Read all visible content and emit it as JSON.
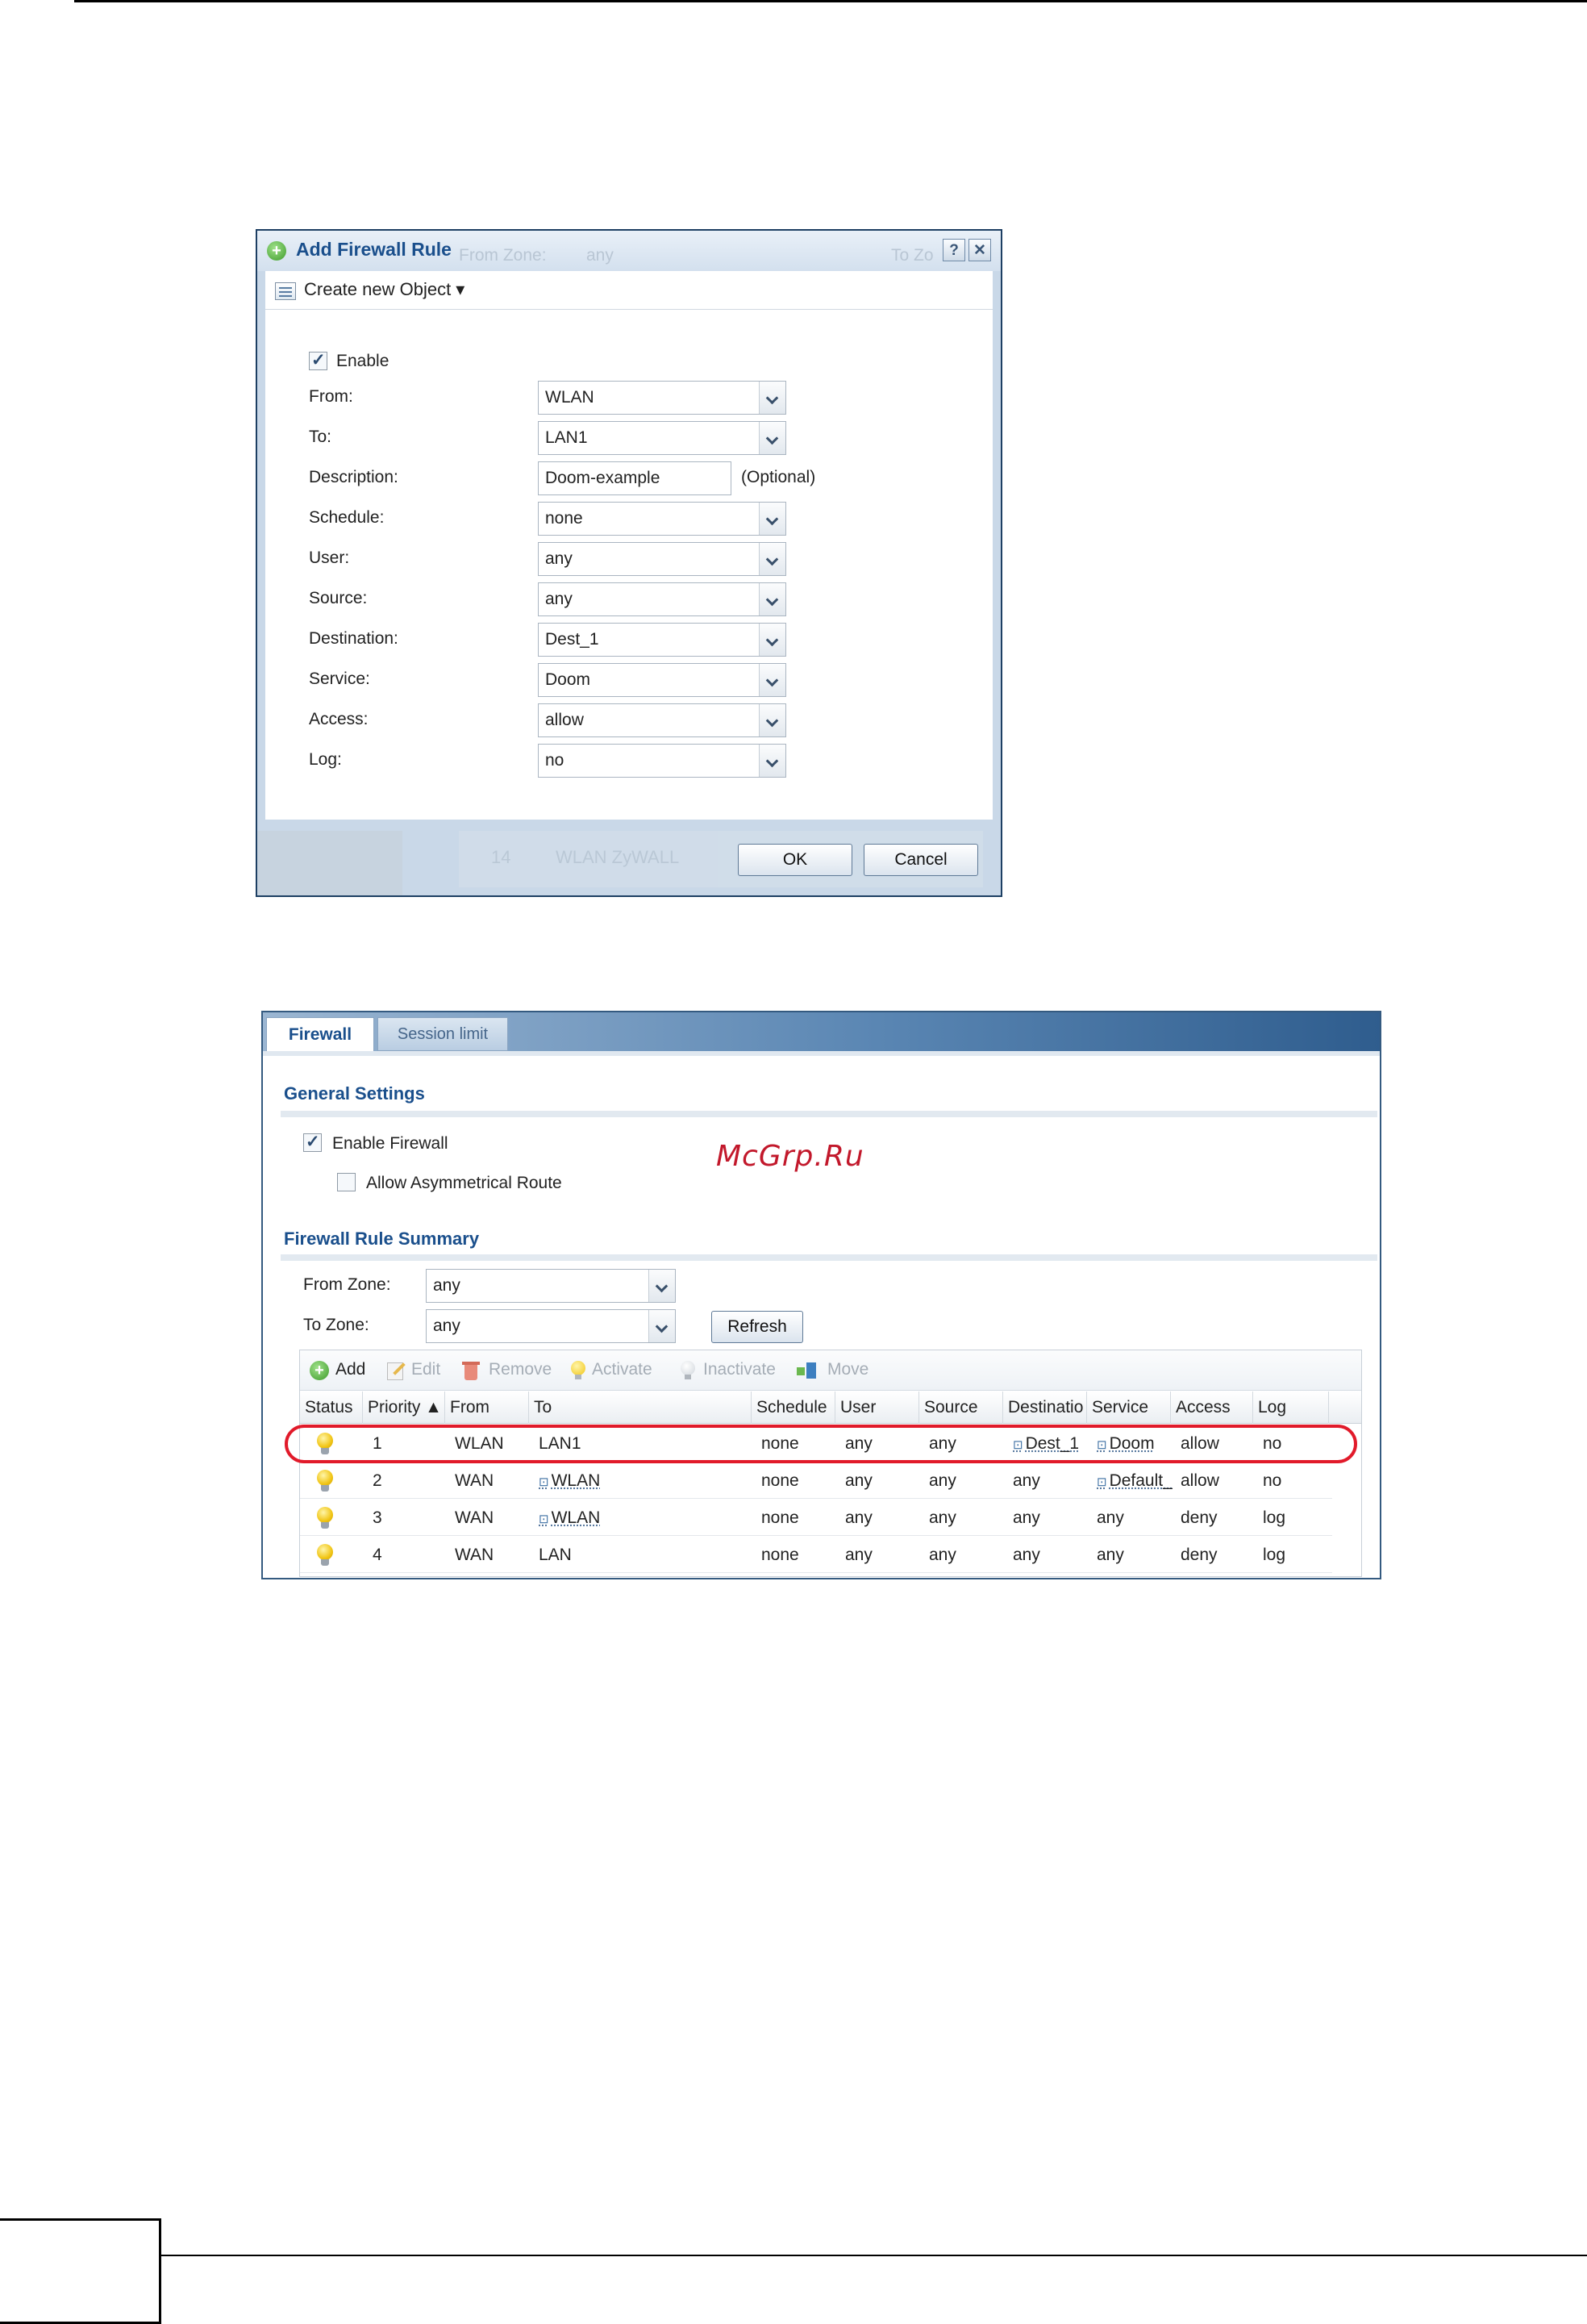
{
  "dialog": {
    "title": "Add Firewall Rule",
    "bg_from_zone": "From Zone:",
    "bg_from_value": "any",
    "bg_to_zone": "To Zo",
    "bg_row_num": "14",
    "bg_row_text": "WLAN ZyWALL",
    "help_label": "?",
    "close_label": "✕",
    "create_object_label": "Create new Object ▾",
    "enable_label": "Enable",
    "enable_checked": true,
    "fields": {
      "from": {
        "label": "From:",
        "value": "WLAN"
      },
      "to": {
        "label": "To:",
        "value": "LAN1"
      },
      "description": {
        "label": "Description:",
        "value": "Doom-example",
        "hint": "(Optional)"
      },
      "schedule": {
        "label": "Schedule:",
        "value": "none"
      },
      "user": {
        "label": "User:",
        "value": "any"
      },
      "source": {
        "label": "Source:",
        "value": "any"
      },
      "destination": {
        "label": "Destination:",
        "value": "Dest_1"
      },
      "service": {
        "label": "Service:",
        "value": "Doom"
      },
      "access": {
        "label": "Access:",
        "value": "allow"
      },
      "log": {
        "label": "Log:",
        "value": "no"
      }
    },
    "ok_label": "OK",
    "cancel_label": "Cancel"
  },
  "firewall": {
    "tabs": [
      {
        "label": "Firewall"
      },
      {
        "label": "Session limit"
      }
    ],
    "general_settings_title": "General Settings",
    "enable_firewall_label": "Enable Firewall",
    "enable_firewall_checked": true,
    "allow_asym_label": "Allow Asymmetrical Route",
    "allow_asym_checked": false,
    "rule_summary_title": "Firewall Rule Summary",
    "from_zone_label": "From Zone:",
    "from_zone_value": "any",
    "to_zone_label": "To Zone:",
    "to_zone_value": "any",
    "refresh_label": "Refresh",
    "toolbar": {
      "add": "Add",
      "edit": "Edit",
      "remove": "Remove",
      "activate": "Activate",
      "inactivate": "Inactivate",
      "move": "Move"
    },
    "columns": [
      "Status",
      "Priority ▲",
      "From",
      "To",
      "Schedule",
      "User",
      "Source",
      "Destinatio",
      "Service",
      "Access",
      "Log"
    ],
    "rows": [
      {
        "priority": "1",
        "from": "WLAN",
        "to": "LAN1",
        "schedule": "none",
        "user": "any",
        "source": "any",
        "destination": "Dest_1",
        "service": "Doom",
        "access": "allow",
        "log": "no"
      },
      {
        "priority": "2",
        "from": "WAN",
        "to": "WLAN",
        "schedule": "none",
        "user": "any",
        "source": "any",
        "destination": "any",
        "service": "Default_",
        "access": "allow",
        "log": "no"
      },
      {
        "priority": "3",
        "from": "WAN",
        "to": "WLAN",
        "schedule": "none",
        "user": "any",
        "source": "any",
        "destination": "any",
        "service": "any",
        "access": "deny",
        "log": "log"
      },
      {
        "priority": "4",
        "from": "WAN",
        "to": "LAN",
        "schedule": "none",
        "user": "any",
        "source": "any",
        "destination": "any",
        "service": "any",
        "access": "deny",
        "log": "log"
      }
    ]
  },
  "watermark": "McGrp.Ru"
}
